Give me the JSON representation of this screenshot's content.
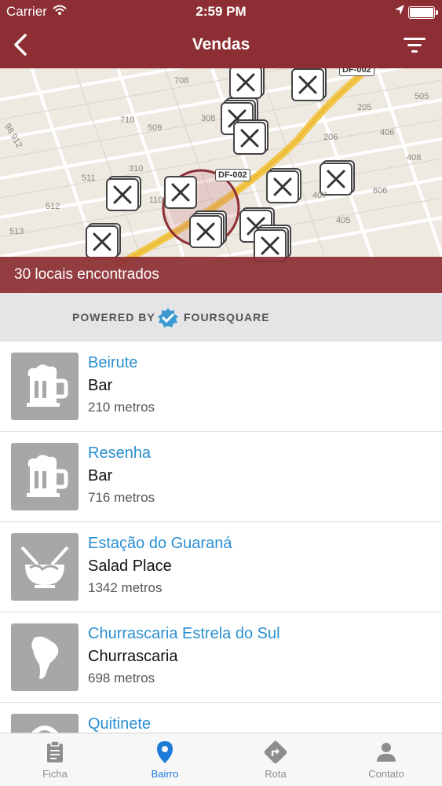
{
  "status_bar": {
    "carrier": "Carrier",
    "time": "2:59 PM"
  },
  "navbar": {
    "title": "Vendas",
    "back_icon": "chevron-left-icon",
    "filter_icon": "filter-icon"
  },
  "map": {
    "found_label": "30 locais encontrados",
    "road_labels": [
      "DF-002",
      "DF-002"
    ],
    "block_labels": [
      "708",
      "710",
      "509",
      "308",
      "310",
      "511",
      "512",
      "513",
      "110",
      "205",
      "206",
      "405",
      "407",
      "606",
      "505",
      "406",
      "408",
      "98 912"
    ]
  },
  "powered": {
    "prefix": "POWERED BY",
    "brand": "FOURSQUARE"
  },
  "places": [
    {
      "name": "Beirute",
      "category": "Bar",
      "distance": "210 metros",
      "icon": "beer-mug-icon"
    },
    {
      "name": "Resenha",
      "category": "Bar",
      "distance": "716 metros",
      "icon": "beer-mug-icon"
    },
    {
      "name": "Estação do Guaraná",
      "category": "Salad Place",
      "distance": "1342 metros",
      "icon": "salad-bowl-icon"
    },
    {
      "name": "Churrascaria Estrela do Sul",
      "category": "Churrascaria",
      "distance": "698 metros",
      "icon": "south-america-icon"
    },
    {
      "name": "Quitinete",
      "category": "",
      "distance": "",
      "icon": "restaurant-icon"
    }
  ],
  "tabs": [
    {
      "label": "Ficha",
      "icon": "clipboard-icon",
      "active": false
    },
    {
      "label": "Bairro",
      "icon": "map-pin-icon",
      "active": true
    },
    {
      "label": "Rota",
      "icon": "route-sign-icon",
      "active": false
    },
    {
      "label": "Contato",
      "icon": "person-icon",
      "active": false
    }
  ],
  "colors": {
    "header": "#8c2e33",
    "link": "#2a8fd1",
    "tab_active": "#1d7bd8",
    "tab_inactive": "#8d8d8d"
  }
}
